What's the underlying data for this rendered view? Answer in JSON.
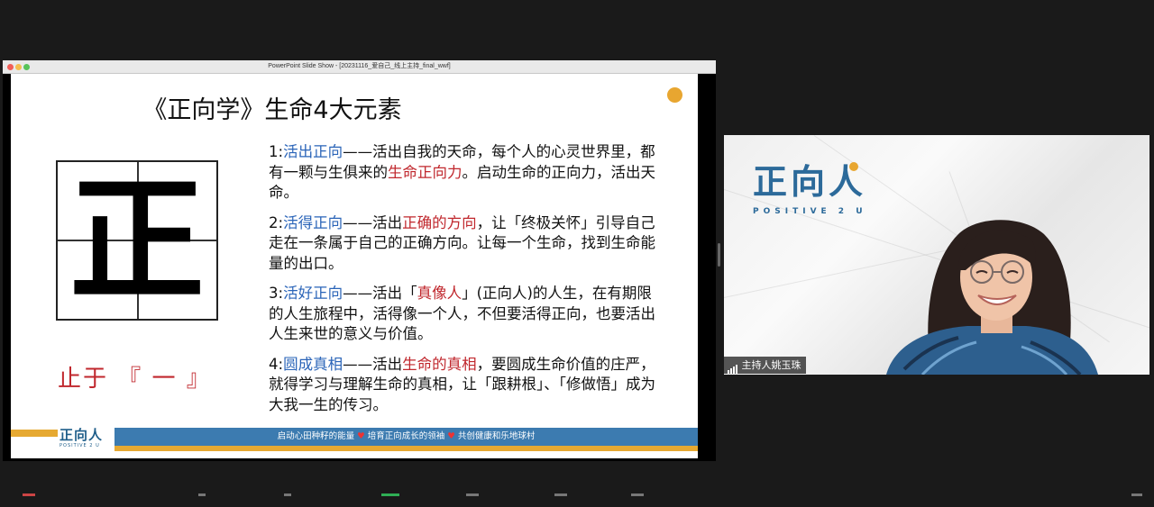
{
  "window": {
    "title": "PowerPoint Slide Show - [20231116_爱自己_线上主持_final_wwf]"
  },
  "slide": {
    "title": "《正向学》生命4大元素",
    "big_char": "正",
    "zhiyu": "止于 『 一 』",
    "points": [
      {
        "num": "1:",
        "key": "活出正向",
        "parts": [
          "——活出自我的天命，每个人的心灵世界里，都有一颗与生俱来的",
          "生命正向力",
          "。启动生命的正向力，活出天命。"
        ]
      },
      {
        "num": "2:",
        "key": "活得正向",
        "parts": [
          "——活出",
          "正确的方向",
          "，让「终极关怀」引导自己走在一条属于自己的正确方向。让每一个生命，找到生命能量的出口。"
        ]
      },
      {
        "num": "3:",
        "key": "活好正向",
        "parts": [
          "——活出「",
          "真像人",
          "」(正向人)的人生，在有期限的人生旅程中，活得像一个人，不但要活得正向，也要活出人生来世的意义与价值。"
        ]
      },
      {
        "num": "4:",
        "key": "圆成真相",
        "parts": [
          "——活出",
          "生命的真相",
          "，要圆成生命价值的庄严，就得学习与理解生命的真相，让「跟耕根」、「修做悟」成为大我一生的传习。"
        ]
      }
    ],
    "footer": {
      "logo": "正向人",
      "logo_sub": "POSITIVE 2 U",
      "slogan_1": "启动心田种籽的能量",
      "slogan_2": "培育正向成长的领袖",
      "slogan_3": "共创健康和乐地球村"
    }
  },
  "video": {
    "logo": "正向人",
    "logo_sub": "POSITIVE 2 U",
    "participant_name": "主持人姚玉珠"
  },
  "colors": {
    "accent_blue": "#2a64b8",
    "accent_red": "#c0272d",
    "brand_blue": "#2c6a9a",
    "brand_gold": "#e6a932"
  }
}
